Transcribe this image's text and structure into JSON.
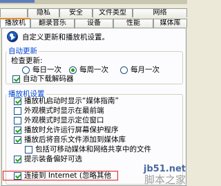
{
  "tabs_row1": [
    "",
    "隐私",
    "安全",
    "文件类型",
    "网络"
  ],
  "tabs_row2": [
    "播放机",
    "翻录音乐",
    "设备",
    "性能",
    "媒体库"
  ],
  "active_tab": "播放机",
  "intro_text": "自定义更新和播放机设置。",
  "auto_update": {
    "title": "自动更新",
    "check_label": "检查更新:",
    "options": [
      "每日一次",
      "每周一次",
      "每月一次"
    ],
    "selected_option": "每周一次",
    "download_codecs": "自动下载解码器"
  },
  "player_settings": {
    "title": "播放机设置",
    "items": [
      {
        "label": "播放机启动时显示“媒体指南”",
        "checked": true
      },
      {
        "label": "外观模式时显示在最前端",
        "checked": false
      },
      {
        "label": "外观模式时显示定位窗口",
        "checked": false
      },
      {
        "label": "播放时允许运行屏幕保护程序",
        "checked": true
      },
      {
        "label": "播放后将音乐文件添加到媒体库",
        "checked": true
      },
      {
        "label": "包括可移动媒体和网络共享中的文件",
        "checked": false
      },
      {
        "label": "提示装备偏好可选",
        "checked": true
      },
      {
        "label": "连接到 Internet (忽略其他",
        "checked": true
      }
    ]
  },
  "watermark": {
    "site": "jb51.net",
    "name": "脚本之家"
  },
  "colors": {
    "accent_tab": "#e68b2c",
    "group_title": "#0046d5",
    "highlight": "#e01b1b"
  }
}
